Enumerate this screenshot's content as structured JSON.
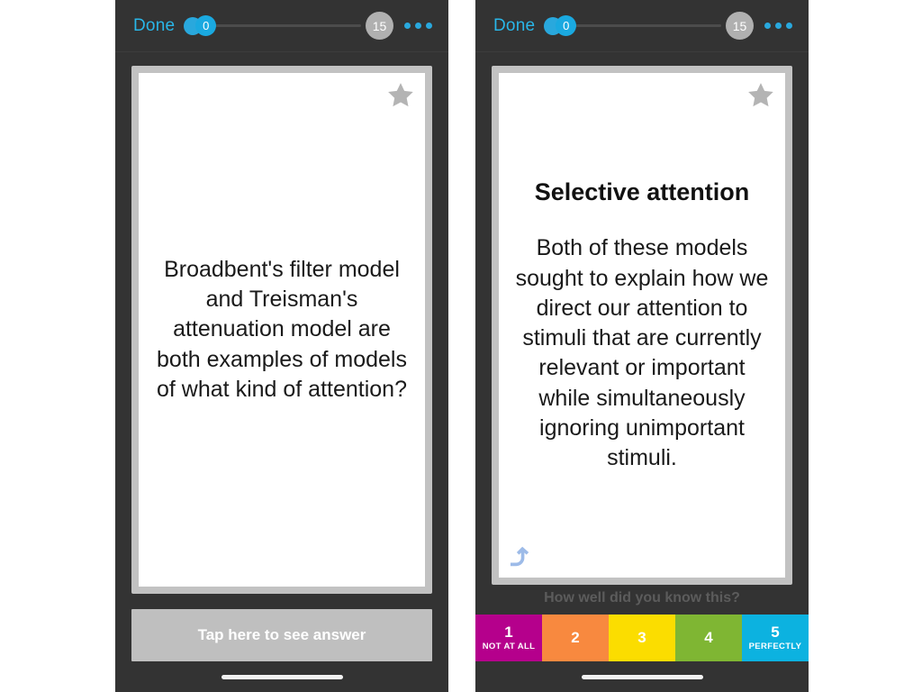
{
  "app": {
    "background_color": "#ffffff",
    "panel_color": "#333333"
  },
  "panels": [
    {
      "id": "left",
      "topbar": {
        "done_label": "Done",
        "progress_count": "0",
        "total_badge": "15",
        "more_icon": "ellipsis-icon",
        "accent_color": "#29b6e8"
      },
      "card": {
        "star_icon": "star-icon",
        "title": "",
        "body": "Broadbent's filter model and Treisman's attenuation model are both examples of models of what kind of attention?",
        "undo_icon": null
      },
      "footer": {
        "type": "tap-button",
        "tap_label": "Tap here to see answer"
      }
    },
    {
      "id": "right",
      "topbar": {
        "done_label": "Done",
        "progress_count": "0",
        "total_badge": "15",
        "more_icon": "ellipsis-icon",
        "accent_color": "#29b6e8"
      },
      "card": {
        "star_icon": "star-icon",
        "title": "Selective attention",
        "body": "Both of these models sought to explain how we direct our attention to stimuli that are currently relevant or important while simultaneously ignoring unimportant stimuli.",
        "undo_icon": "undo-arrow-icon"
      },
      "footer": {
        "type": "rating",
        "prompt": "How well did you know this?",
        "options": [
          {
            "number": "1",
            "sub": "NOT AT ALL",
            "color": "#b5008c"
          },
          {
            "number": "2",
            "sub": "",
            "color": "#f8893f"
          },
          {
            "number": "3",
            "sub": "",
            "color": "#fbdd00"
          },
          {
            "number": "4",
            "sub": "",
            "color": "#7fb633"
          },
          {
            "number": "5",
            "sub": "PERFECTLY",
            "color": "#0cb2e0"
          }
        ]
      }
    }
  ]
}
